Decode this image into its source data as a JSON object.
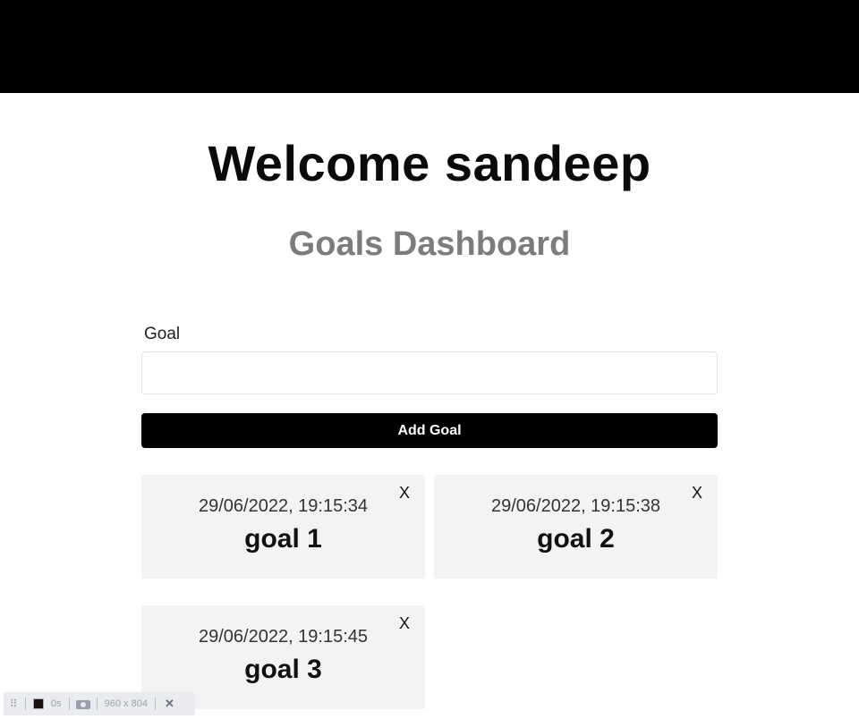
{
  "header": {
    "welcome": "Welcome sandeep",
    "subtitle": "Goals Dashboard"
  },
  "form": {
    "goal_label": "Goal",
    "goal_value": "",
    "goal_placeholder": "",
    "add_button_label": "Add Goal"
  },
  "goals": [
    {
      "date": "29/06/2022, 19:15:34",
      "text": "goal 1",
      "delete_label": "X"
    },
    {
      "date": "29/06/2022, 19:15:38",
      "text": "goal 2",
      "delete_label": "X"
    },
    {
      "date": "29/06/2022, 19:15:45",
      "text": "goal 3",
      "delete_label": "X"
    }
  ],
  "devtools": {
    "grip_icon": "drag-handle-icon",
    "color_swatch": "#1a0f0f",
    "time": "0s",
    "camera_icon": "camera-icon",
    "viewport": "960 x 804",
    "close_label": "✕"
  },
  "colors": {
    "top_bar": "#000000",
    "subtitle": "#7c7c7c",
    "card_bg": "#f3f3f3",
    "button_bg": "#000000"
  }
}
